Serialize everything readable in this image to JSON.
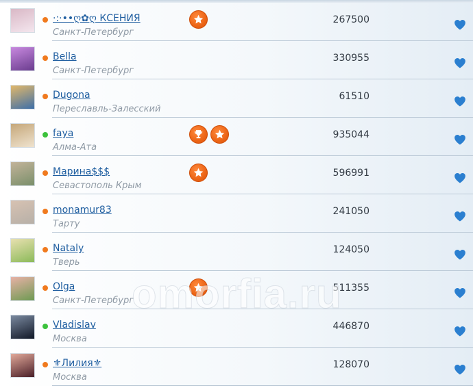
{
  "colors": {
    "online": "#3cc23c",
    "offline": "#f07a1e",
    "badge": "#ec6516",
    "link": "#1f5ea0",
    "heart": "#2b7fd0"
  },
  "watermark": "omorfia.ru",
  "users": [
    {
      "name": "·:·••ღ✿ღ КСЕНИЯ",
      "city": "Санкт-Петербург",
      "score": "267500",
      "status": "offline",
      "badges": [
        "star-icon"
      ],
      "avatar": [
        "#f4e6ee",
        "#d9b8c6"
      ]
    },
    {
      "name": " Bella",
      "city": "Санкт-Петербург",
      "score": "330955",
      "status": "offline",
      "badges": [],
      "avatar": [
        "#6a3c8e",
        "#c889df"
      ]
    },
    {
      "name": " Dugona",
      "city": "Переславль-Залесский",
      "score": "61510",
      "status": "offline",
      "badges": [],
      "avatar": [
        "#3e6fa8",
        "#e2b86a"
      ]
    },
    {
      "name": " faya",
      "city": "Алма-Ата",
      "score": "935044",
      "status": "online",
      "badges": [
        "trophy-icon",
        "star-icon"
      ],
      "avatar": [
        "#efe3cf",
        "#c5a77a"
      ]
    },
    {
      "name": " Марина$$$",
      "city": "Севастополь Крым",
      "score": "596991",
      "status": "offline",
      "badges": [
        "star-icon"
      ],
      "avatar": [
        "#7a8f6a",
        "#c2b39a"
      ]
    },
    {
      "name": " monamur83",
      "city": "Тарту",
      "score": "241050",
      "status": "offline",
      "badges": [],
      "avatar": [
        "#b7b0a8",
        "#d7c2b2"
      ]
    },
    {
      "name": " Nataly",
      "city": "Тверь",
      "score": "124050",
      "status": "offline",
      "badges": [],
      "avatar": [
        "#8cba5a",
        "#e8e0b0"
      ]
    },
    {
      "name": " Olga",
      "city": "Санкт-Петербург",
      "score": "511355",
      "status": "offline",
      "badges": [
        "star-icon"
      ],
      "avatar": [
        "#6e9a52",
        "#e7b1a6"
      ]
    },
    {
      "name": " Vladislav",
      "city": "Москва",
      "score": "446870",
      "status": "online",
      "badges": [],
      "avatar": [
        "#111827",
        "#7b8aa0"
      ]
    },
    {
      "name": " ⚜Лилия⚜",
      "city": "Москва",
      "score": "128070",
      "status": "offline",
      "badges": [],
      "avatar": [
        "#4a1f28",
        "#e2a99a"
      ]
    }
  ]
}
